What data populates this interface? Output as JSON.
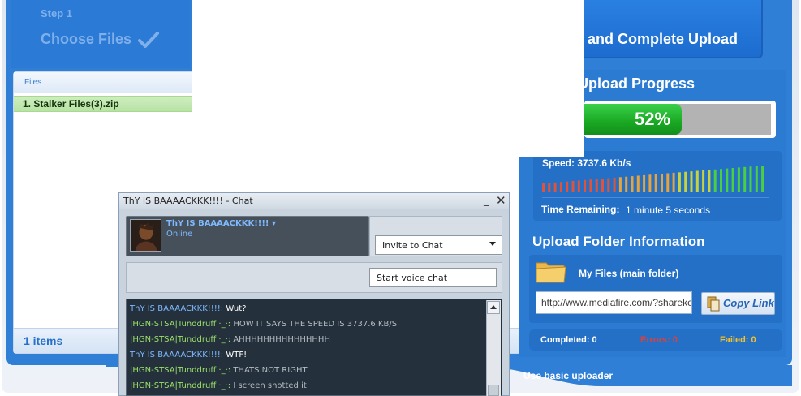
{
  "step": {
    "label": "Step 1",
    "title": "Choose Files"
  },
  "complete_upload": {
    "label": "and Complete Upload"
  },
  "files": {
    "header_label": "Files",
    "items": [
      {
        "name": "1. Stalker Files(3).zip"
      }
    ],
    "count_label": "1 items"
  },
  "progress": {
    "title": "Upload Progress",
    "percent": 52,
    "percent_label": "52%",
    "speed_label": "Speed: 3737.6 Kb/s",
    "time_label": "Time Remaining:",
    "time_value": "1 minute 5 seconds"
  },
  "folder": {
    "title": "Upload Folder Information",
    "name": "My Files (main folder)",
    "link_value": "http://www.mediafire.com/?sharekey=",
    "copy_label": "Copy Link"
  },
  "stats": {
    "completed": "Completed:  0",
    "errors": "Errors:  0",
    "failed": "Failed: 0"
  },
  "basic_uploader_label": "Use basic uploader",
  "chat": {
    "title": "ThY IS BAAAACKKK!!!! - Chat",
    "min_glyph": "_",
    "close_glyph": "✕",
    "contact_name": "ThY IS BAAAACKKK!!!! ▾",
    "contact_status": "Online",
    "invite_label": "Invite to Chat",
    "voice_label": "Start voice chat",
    "messages": [
      {
        "who": "ThY IS BAAAACKKK!!!!:",
        "text": "Wut?"
      },
      {
        "who": "|HGN-STSA|Tunddruff ·_·:",
        "text": "HOW IT SAYS THE SPEED IS 3737.6 KB/S"
      },
      {
        "who": "|HGN-STSA|Tunddruff ·_·:",
        "text": "AHHHHHHHHHHHHHHH"
      },
      {
        "who": "ThY IS BAAAACKKK!!!!:",
        "text": "WTF!"
      },
      {
        "who": "|HGN-STSA|Tunddruff ·_·:",
        "text": "THATS NOT RIGHT"
      },
      {
        "who": "|HGN-STSA|Tunddruff ·_·:",
        "text": "I screen shotted it"
      }
    ]
  },
  "colors": {
    "brand_blue": "#2f7fd6",
    "progress_green": "#1aa823",
    "error_red": "#e0403a",
    "failed_yellow": "#f0c030"
  },
  "icons": {
    "check": "check-icon",
    "folder": "folder-icon",
    "copy": "copy-icon",
    "chevron": "chevron-down-icon"
  }
}
